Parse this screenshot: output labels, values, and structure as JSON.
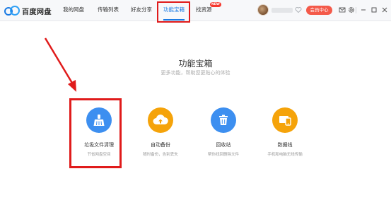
{
  "app": {
    "logo_text": "百度网盘"
  },
  "nav": {
    "items": [
      {
        "label": "我的网盘"
      },
      {
        "label": "传输列表"
      },
      {
        "label": "好友分享"
      },
      {
        "label": "功能宝箱",
        "active": true
      },
      {
        "label": "找资源",
        "badge": "NEW"
      }
    ]
  },
  "user": {
    "vip_label": "会员中心"
  },
  "toolbar_icons": [
    "heart-icon",
    "mail-icon",
    "settings-icon",
    "minimize-icon",
    "maximize-icon",
    "close-icon"
  ],
  "main": {
    "title": "功能宝箱",
    "subtitle": "更多功能，帮助您更贴心的体验",
    "tools": [
      {
        "name": "垃圾文件清理",
        "desc": "节省网盘空间",
        "icon": "broom-icon",
        "color": "#3d8ff0"
      },
      {
        "name": "自动备份",
        "desc": "随时备份，告别丢失",
        "icon": "cloud-upload-icon",
        "color": "#f5a30a"
      },
      {
        "name": "回收站",
        "desc": "帮你找回删除文件",
        "icon": "trash-icon",
        "color": "#3d8ff0"
      },
      {
        "name": "数据线",
        "desc": "手机和电脑无线传输",
        "icon": "devices-icon",
        "color": "#f5a30a"
      }
    ]
  },
  "colors": {
    "accent": "#1a7ae3",
    "vip": "#f45a4a",
    "annotation": "#e01b1b"
  }
}
